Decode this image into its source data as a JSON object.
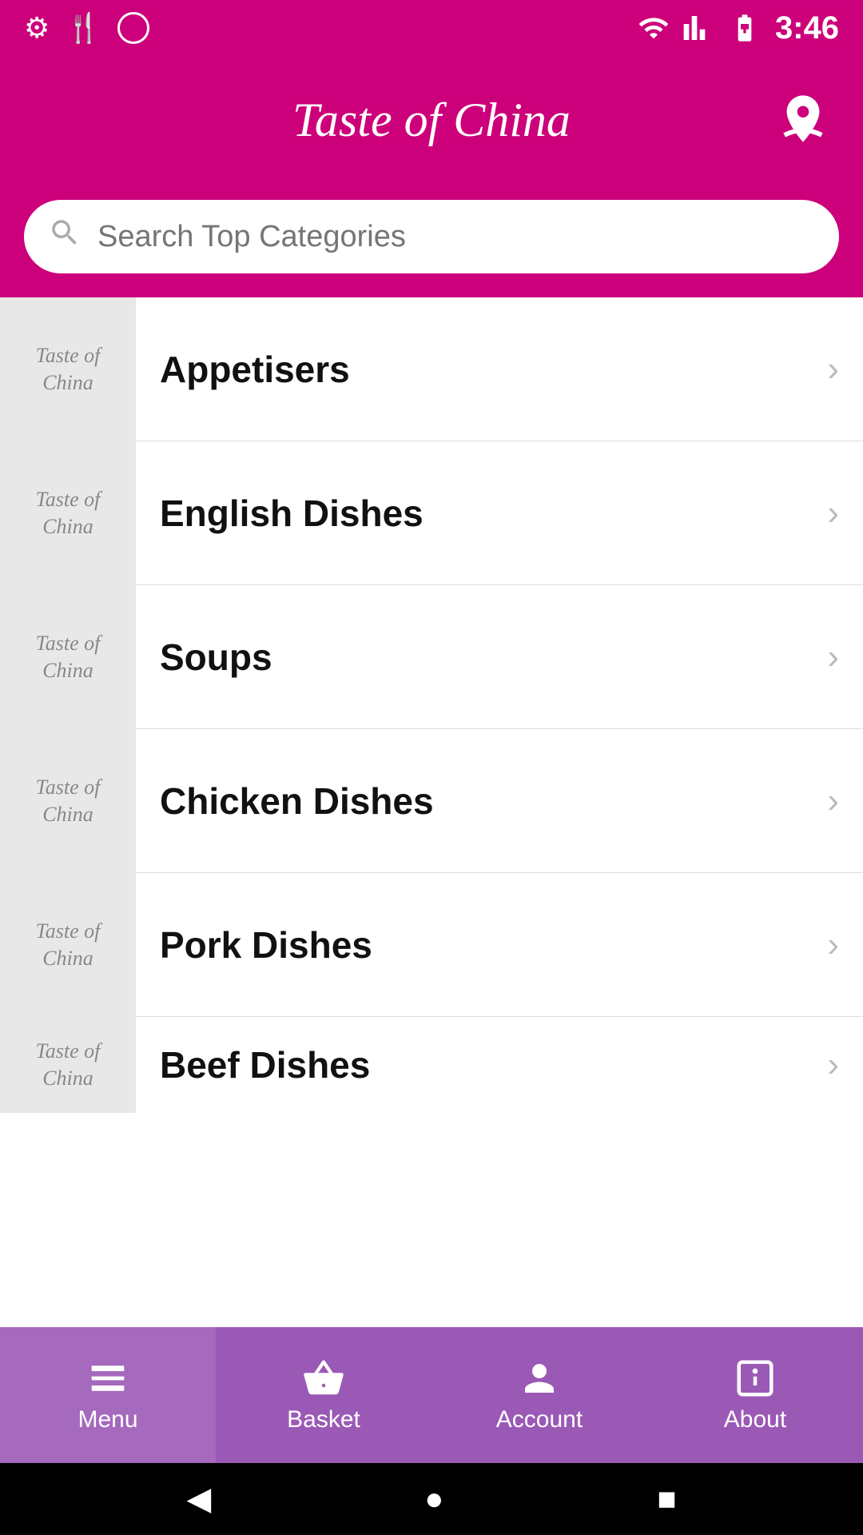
{
  "status_bar": {
    "time": "3:46",
    "icons": {
      "settings": "⚙",
      "fork": "🍴",
      "wifi": "▲",
      "signal": "▲",
      "battery": "🔋"
    }
  },
  "header": {
    "title": "Taste of China",
    "location_label": "location"
  },
  "search": {
    "placeholder": "Search Top Categories"
  },
  "categories": [
    {
      "id": 1,
      "name": "Appetisers",
      "thumb_line1": "Taste of",
      "thumb_line2": "China"
    },
    {
      "id": 2,
      "name": "English Dishes",
      "thumb_line1": "Taste of",
      "thumb_line2": "China"
    },
    {
      "id": 3,
      "name": "Soups",
      "thumb_line1": "Taste of",
      "thumb_line2": "China"
    },
    {
      "id": 4,
      "name": "Chicken Dishes",
      "thumb_line1": "Taste of",
      "thumb_line2": "China"
    },
    {
      "id": 5,
      "name": "Pork Dishes",
      "thumb_line1": "Taste of",
      "thumb_line2": "China"
    },
    {
      "id": 6,
      "name": "Beef Dishes",
      "thumb_line1": "Taste of",
      "thumb_line2": "China"
    }
  ],
  "nav": {
    "items": [
      {
        "id": "menu",
        "label": "Menu",
        "icon": "menu",
        "active": true
      },
      {
        "id": "basket",
        "label": "Basket",
        "icon": "basket",
        "active": false
      },
      {
        "id": "account",
        "label": "Account",
        "icon": "account",
        "active": false
      },
      {
        "id": "about",
        "label": "About",
        "icon": "about",
        "active": false
      }
    ]
  },
  "android_bar": {
    "back": "◀",
    "home": "●",
    "square": "■"
  }
}
